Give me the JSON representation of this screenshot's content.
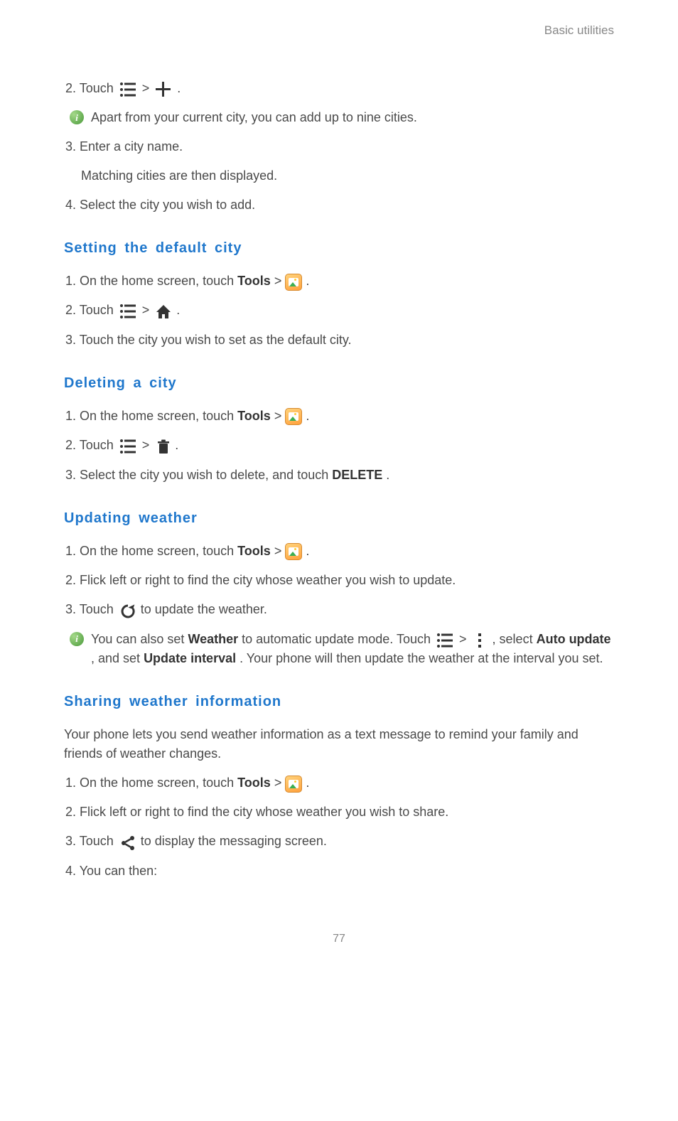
{
  "header": "Basic utilities",
  "page_number": "77",
  "intro": {
    "step2_prefix": "2. Touch ",
    "step2_sep": " > ",
    "step2_suffix": " .",
    "note": "Apart from your current city, you can add up to nine cities.",
    "step3": "3. Enter a city name.",
    "step3_sub": "Matching cities are then displayed.",
    "step4": "4. Select the city you wish to add."
  },
  "section1": {
    "heading": "Setting the default city",
    "step1_prefix": "1. On the home screen, touch ",
    "tools_label": "Tools",
    "step1_sep": " > ",
    "step1_suffix": " .",
    "step2_prefix": "2. Touch ",
    "step2_sep": " > ",
    "step2_suffix": " .",
    "step3": "3. Touch the city you wish to set as the default city."
  },
  "section2": {
    "heading": "Deleting a city",
    "step1_prefix": "1. On the home screen, touch ",
    "tools_label": "Tools",
    "step1_sep": " > ",
    "step1_suffix": " .",
    "step2_prefix": "2. Touch ",
    "step2_sep": " > ",
    "step2_suffix": " .",
    "step3_a": "3. Select the city you wish to delete, and touch ",
    "delete_label": "DELETE",
    "step3_b": "."
  },
  "section3": {
    "heading": "Updating weather",
    "step1_prefix": "1. On the home screen, touch ",
    "tools_label": "Tools",
    "step1_sep": " > ",
    "step1_suffix": " .",
    "step2": "2. Flick left or right to find the city whose weather you wish to update.",
    "step3_prefix": "3. Touch ",
    "step3_suffix": " to update the weather.",
    "note_a": "You can also set ",
    "weather_label": "Weather",
    "note_b": " to automatic update mode. Touch ",
    "note_sep": " > ",
    "note_c": " , select ",
    "auto_update_label": "Auto update",
    "note_d": ", and set ",
    "update_interval_label": "Update interval",
    "note_e": ". Your phone will then update the weather at the interval you set."
  },
  "section4": {
    "heading": "Sharing weather information",
    "intro": "Your phone lets you send weather information as a text message to remind your family and friends of weather changes.",
    "step1_prefix": "1. On the home screen, touch ",
    "tools_label": "Tools",
    "step1_sep": " > ",
    "step1_suffix": " .",
    "step2": "2. Flick left or right to find the city whose weather you wish to share.",
    "step3_prefix": "3. Touch ",
    "step3_suffix": " to display the messaging screen.",
    "step4": "4. You can then:"
  }
}
